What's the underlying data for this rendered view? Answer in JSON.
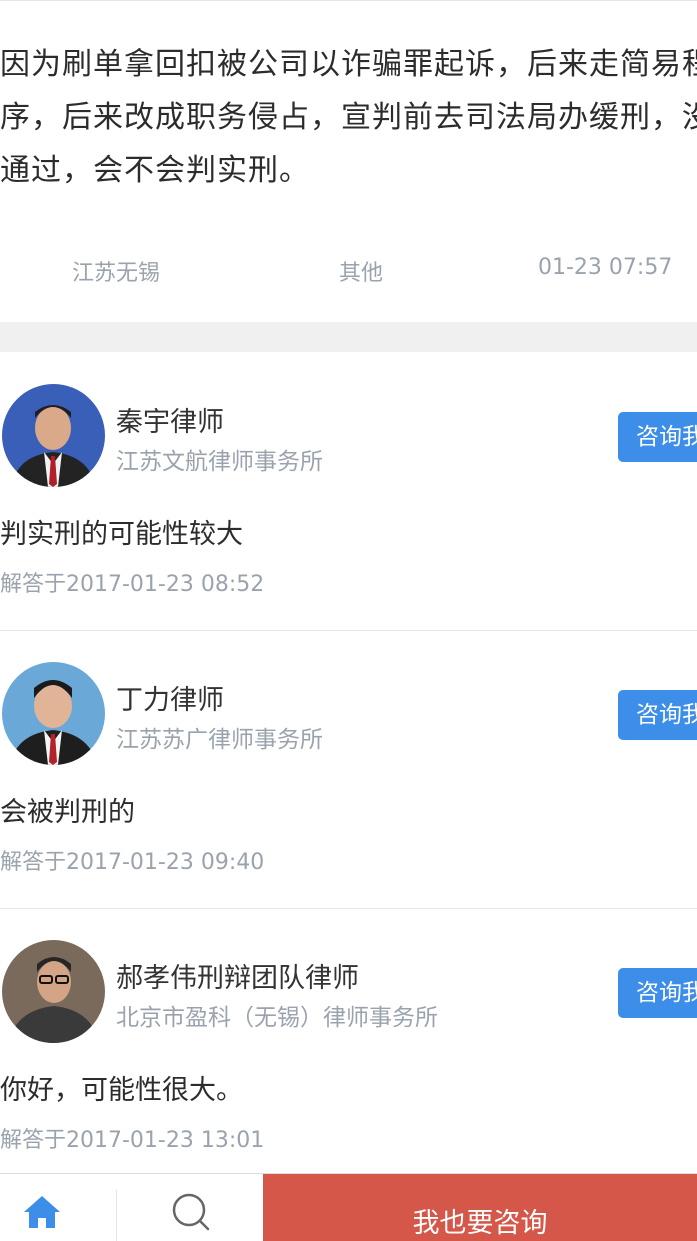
{
  "question": {
    "text": "因为刷单拿回扣被公司以诈骗罪起诉，后来走简易程序，后来改成职务侵占，宣判前去司法局办缓刑，没通过，会不会判实刑。",
    "location": "江苏无锡",
    "category": "其他",
    "time": "01-23 07:57"
  },
  "answers": [
    {
      "lawyer_name": "秦宇律师",
      "law_firm": "江苏文航律师事务所",
      "consult_label": "咨询我",
      "text": "判实刑的可能性较大",
      "answered_at": "解答于2017-01-23 08:52"
    },
    {
      "lawyer_name": "丁力律师",
      "law_firm": "江苏苏广律师事务所",
      "consult_label": "咨询我",
      "text": "会被判刑的",
      "answered_at": "解答于2017-01-23 09:40"
    },
    {
      "lawyer_name": "郝孝伟刑辩团队律师",
      "law_firm": "北京市盈科（无锡）律师事务所",
      "consult_label": "咨询我",
      "text": "你好，可能性很大。",
      "answered_at": "解答于2017-01-23 13:01"
    }
  ],
  "bottom_bar": {
    "home_icon": "home-icon",
    "search_icon": "search-icon",
    "consult_label": "我也要咨询"
  },
  "colors": {
    "primary_blue": "#3d8ee8",
    "consult_red": "#d4574a",
    "muted_text": "#9aa3ad"
  }
}
